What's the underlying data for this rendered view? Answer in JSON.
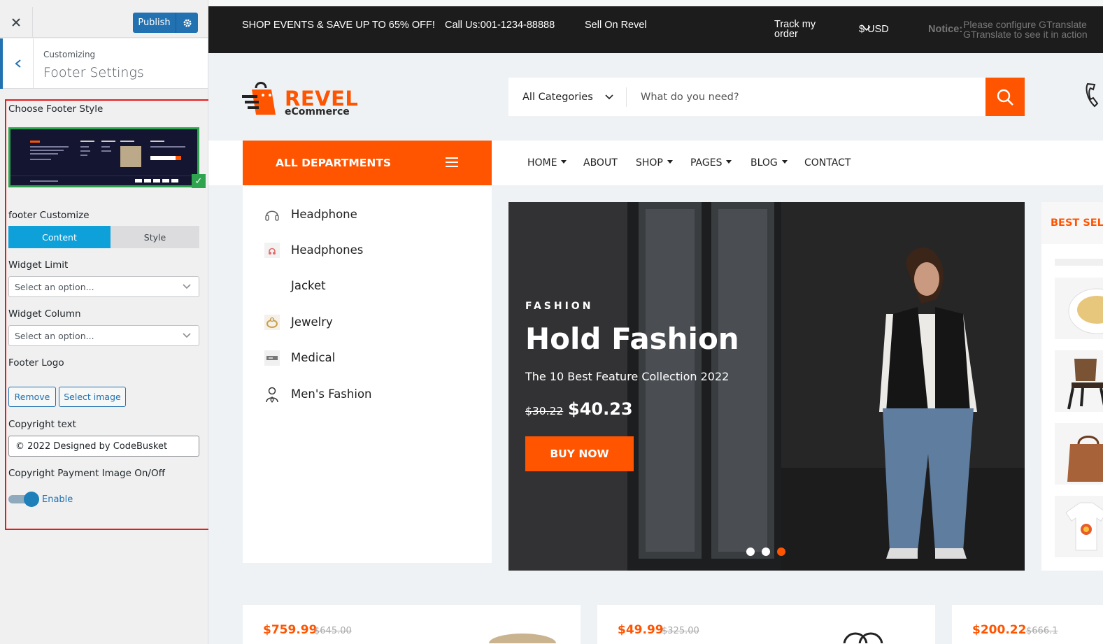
{
  "sidebar": {
    "publish_label": "Publish",
    "breadcrumb": "Customizing",
    "title": "Footer Settings",
    "choose_style_label": "Choose Footer Style",
    "customize_label": "footer Customize",
    "tabs": [
      "Content",
      "Style"
    ],
    "widget_limit_label": "Widget Limit",
    "widget_limit_value": "Select an option...",
    "widget_column_label": "Widget Column",
    "widget_column_value": "Select an option...",
    "footer_logo_label": "Footer Logo",
    "remove_label": "Remove",
    "select_image_label": "Select image",
    "copyright_label": "Copyright text",
    "copyright_value": "© 2022 Designed by CodeBusket",
    "payment_label": "Copyright Payment Image On/Off",
    "payment_state": "Enable"
  },
  "topbar": {
    "promo": "SHOP EVENTS & SAVE UP TO 65% OFF!",
    "phone": "Call Us:001-1234-88888",
    "sell": "Sell On Revel",
    "track_line1": "Track my",
    "track_line2": "order",
    "currency": "$ USD",
    "notice_key": "Notice:",
    "notice_line1": "Please configure GTranslate",
    "notice_line2": "GTranslate to see it in action"
  },
  "header": {
    "brand": "REVEL",
    "brand_sub": "eCommerce",
    "search_category": "All Categories",
    "search_placeholder": "What do you need?"
  },
  "nav": {
    "all_departments": "ALL DEPARTMENTS",
    "items": [
      {
        "label": "HOME",
        "dropdown": true
      },
      {
        "label": "ABOUT",
        "dropdown": false
      },
      {
        "label": "SHOP",
        "dropdown": true
      },
      {
        "label": "PAGES",
        "dropdown": true
      },
      {
        "label": "BLOG",
        "dropdown": true
      },
      {
        "label": "CONTACT",
        "dropdown": false
      }
    ]
  },
  "departments": [
    {
      "label": "Headphone",
      "icon": "headset-icon"
    },
    {
      "label": "Headphones",
      "icon": "headphones-icon"
    },
    {
      "label": "Jacket",
      "icon": ""
    },
    {
      "label": "Jewelry",
      "icon": "ring-icon"
    },
    {
      "label": "Medical",
      "icon": "medical-icon"
    },
    {
      "label": "Men's Fashion",
      "icon": "man-icon"
    }
  ],
  "hero": {
    "eyebrow": "FASHION",
    "heading": "Hold Fashion",
    "subheading": "The 10 Best Feature Collection 2022",
    "old_price": "$30.22",
    "new_price": "$40.23",
    "button": "BUY NOW",
    "slides": 3,
    "active_slide": 3
  },
  "best_sellers": {
    "title": "BEST SELLERS"
  },
  "product_cards": [
    {
      "price": "$759.99",
      "was": "$645.00"
    },
    {
      "price": "$49.99",
      "was": "$325.00"
    },
    {
      "price": "$200.22",
      "was": "$666.1"
    }
  ],
  "colors": {
    "accent": "#ff5400",
    "wp_blue": "#2271b1",
    "segment_active": "#0ea1d9",
    "topbar_bg": "#1c1c1c",
    "highlight_outline": "#e81b1b",
    "selected_green": "#2ea44f"
  }
}
